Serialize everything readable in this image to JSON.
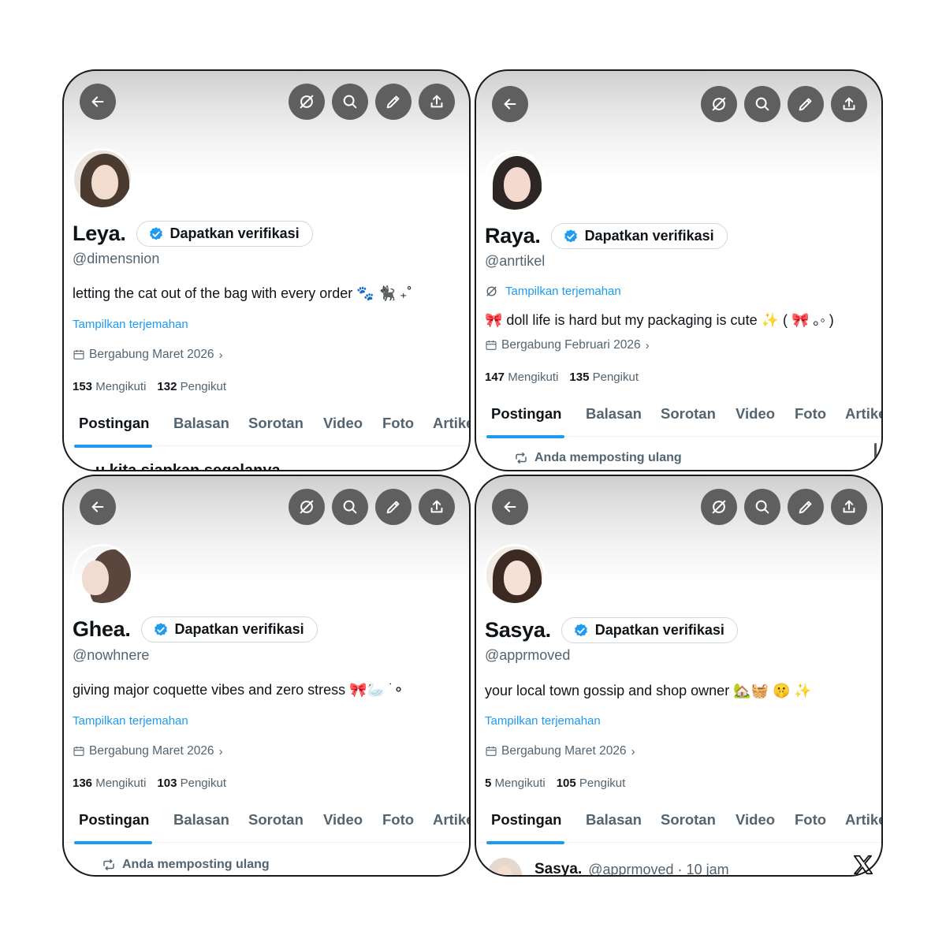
{
  "cards": [
    {
      "display_name": "Leya.",
      "handle": "@dimensnion",
      "verify_label": "Dapatkan verifikasi",
      "bio": "letting the cat out of the bag with every order 🐾 🐈‍⬛ ₊˚",
      "translate_label": "Tampilkan terjemahan",
      "joined": "Bergabung Maret 2026",
      "following_count": "153",
      "following_label": "Mengikuti",
      "followers_count": "132",
      "followers_label": "Pengikut",
      "below_text": "u kita siapkan segalanya"
    },
    {
      "display_name": "Raya.",
      "handle": "@anrtikel",
      "verify_label": "Dapatkan verifikasi",
      "bio": "🎀 doll life is hard but my packaging is cute ✨ ( 🎀 ｡◦ )",
      "translate_label": "Tampilkan terjemahan",
      "joined": "Bergabung Februari 2026",
      "following_count": "147",
      "following_label": "Mengikuti",
      "followers_count": "135",
      "followers_label": "Pengikut",
      "below_text": "Anda memposting ulang"
    },
    {
      "display_name": "Ghea.",
      "handle": "@nowhnere",
      "verify_label": "Dapatkan verifikasi",
      "bio": "giving major coquette vibes and zero stress 🎀🦢 ࣪ ⚬",
      "translate_label": "Tampilkan terjemahan",
      "joined": "Bergabung Maret 2026",
      "following_count": "136",
      "following_label": "Mengikuti",
      "followers_count": "103",
      "followers_label": "Pengikut",
      "below_text": "Anda memposting ulang"
    },
    {
      "display_name": "Sasya.",
      "handle": "@apprmoved",
      "verify_label": "Dapatkan verifikasi",
      "bio": "your local town gossip and shop owner 🏡🧺 🤫 ✨",
      "translate_label": "Tampilkan terjemahan",
      "joined": "Bergabung Maret 2026",
      "following_count": "5",
      "following_label": "Mengikuti",
      "followers_count": "105",
      "followers_label": "Pengikut",
      "post_author": "Sasya.",
      "post_meta": "@apprmoved · 10 jam"
    }
  ],
  "tabs": [
    "Postingan",
    "Balasan",
    "Sorotan",
    "Video",
    "Foto",
    "Artikel"
  ],
  "icons": {
    "back": "arrow-left-icon",
    "translate": "translate-icon",
    "search": "search-icon",
    "edit": "pencil-icon",
    "share": "share-icon",
    "calendar": "calendar-icon",
    "retweet": "retweet-icon",
    "verified": "verified-badge-icon",
    "brand": "x-logo-icon"
  },
  "colors": {
    "accent": "#1d9bf0",
    "text": "#0f1419",
    "muted": "#536471",
    "icon_button": "#5f5f5f"
  }
}
